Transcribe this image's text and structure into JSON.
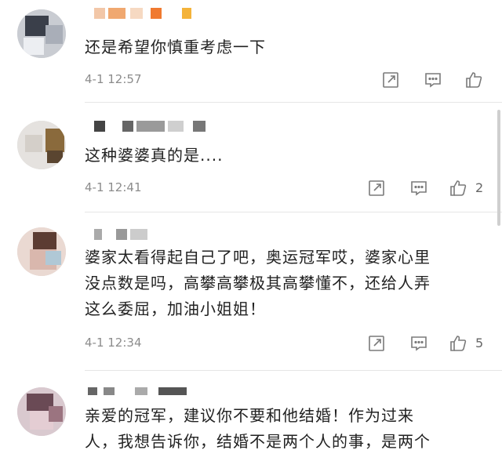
{
  "colors": {
    "text": "#222222",
    "meta": "#8c8c8c",
    "icon": "#7a7a7a",
    "divider": "#e6e6e6",
    "background": "#ffffff"
  },
  "comments": [
    {
      "text": "还是希望你慎重考虑一下",
      "time": "4-1 12:57",
      "likes": "",
      "icons": [
        "share-icon",
        "comment-icon",
        "thumbs-up-icon"
      ]
    },
    {
      "text": "这种婆婆真的是....",
      "time": "4-1 12:41",
      "likes": "2",
      "icons": [
        "share-icon",
        "comment-icon",
        "thumbs-up-icon"
      ]
    },
    {
      "text": "婆家太看得起自己了吧，奥运冠军哎，婆家心里\n没点数是吗，高攀高攀极其高攀懂不，还给人弄\n这么委屈，加油小姐姐！",
      "time": "4-1 12:34",
      "likes": "5",
      "icons": [
        "share-icon",
        "comment-icon",
        "thumbs-up-icon"
      ]
    },
    {
      "text": "亲爱的冠军，建议你不要和他结婚！作为过来\n人，我想告诉你，结婚不是两个人的事，是两个",
      "time": "",
      "likes": "",
      "icons": []
    }
  ]
}
